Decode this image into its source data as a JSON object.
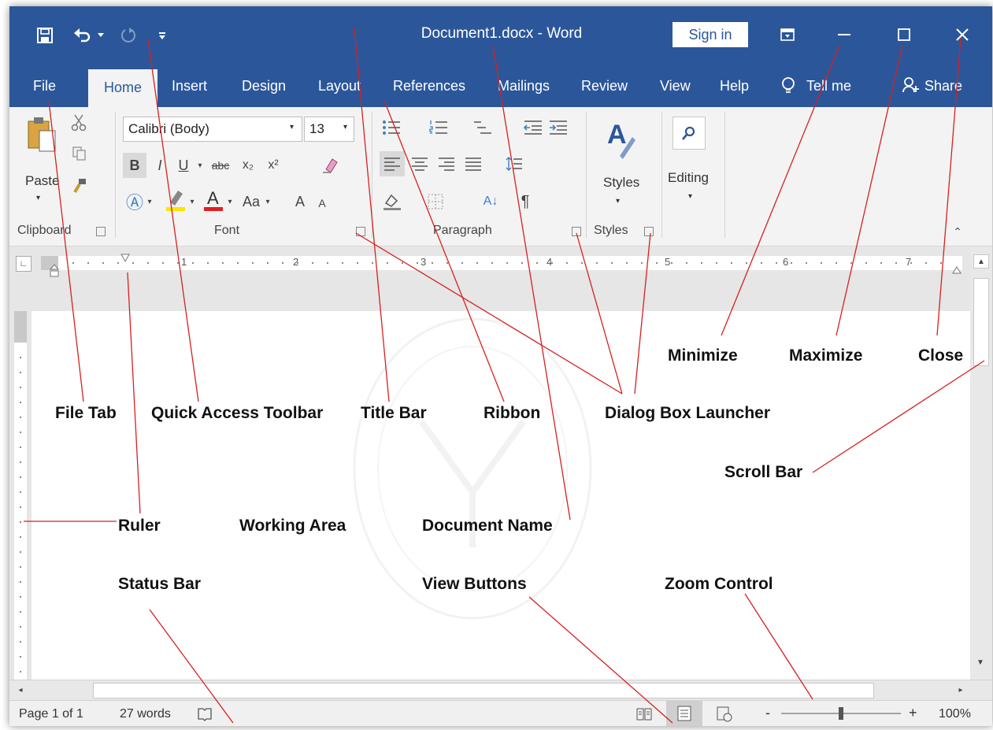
{
  "title_bar": {
    "document_title": "Document1.docx - Word",
    "sign_in": "Sign in",
    "icons": [
      "save-icon",
      "undo-icon",
      "redo-icon",
      "customize-qat-icon",
      "ribbon-display-icon",
      "minimize-icon",
      "maximize-icon",
      "close-icon"
    ]
  },
  "tabs": [
    {
      "label": "File"
    },
    {
      "label": "Home"
    },
    {
      "label": "Insert"
    },
    {
      "label": "Design"
    },
    {
      "label": "Layout"
    },
    {
      "label": "References"
    },
    {
      "label": "Mailings"
    },
    {
      "label": "Review"
    },
    {
      "label": "View"
    },
    {
      "label": "Help"
    },
    {
      "label": "Tell me"
    },
    {
      "label": "Share"
    }
  ],
  "ribbon": {
    "clipboard": {
      "paste": "Paste",
      "label": "Clipboard"
    },
    "font": {
      "name": "Calibri (Body)",
      "size": "13",
      "label": "Font",
      "bold": "B",
      "italic": "I",
      "underline": "U",
      "strike": "abc",
      "subscript": "x₂",
      "superscript": "x²",
      "change_case": "Aa",
      "grow": "A",
      "shrink": "A"
    },
    "paragraph": {
      "label": "Paragraph",
      "sort": "A↓",
      "pilcrow": "¶"
    },
    "styles": {
      "button": "Styles",
      "label": "Styles"
    },
    "editing": {
      "button": "Editing"
    }
  },
  "ruler": {
    "numbers": [
      "1",
      "2",
      "3",
      "4",
      "5",
      "6",
      "7"
    ]
  },
  "status_bar": {
    "page": "Page 1 of 1",
    "words": "27 words",
    "zoom_minus": "-",
    "zoom_plus": "+",
    "zoom": "100%",
    "zoom_level_percent": 100
  },
  "callouts": {
    "minimize": "Minimize",
    "maximize": "Maximize",
    "close": "Close",
    "file_tab": "File Tab",
    "quick_access_toolbar": "Quick Access Toolbar",
    "title_bar": "Title Bar",
    "ribbon": "Ribbon",
    "dialog_box_launcher": "Dialog Box Launcher",
    "scroll_bar": "Scroll Bar",
    "ruler": "Ruler",
    "working_area": "Working Area",
    "document_name": "Document Name",
    "status_bar": "Status Bar",
    "view_buttons": "View Buttons",
    "zoom_control": "Zoom Control"
  },
  "colors": {
    "title_bar": "#2b579a",
    "leader_line": "#d62020",
    "ribbon_bg": "#f3f3f3"
  }
}
